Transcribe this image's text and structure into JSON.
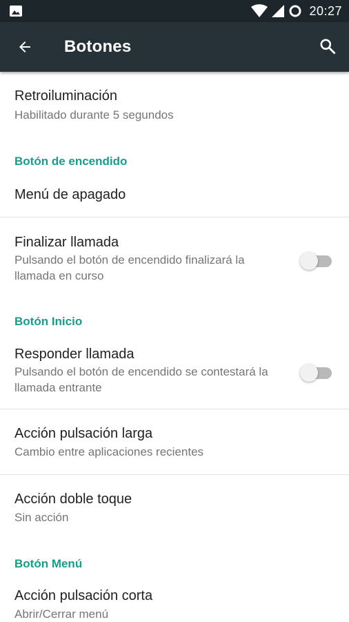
{
  "status_bar": {
    "time": "20:27",
    "icons": [
      "image-icon",
      "wifi-icon",
      "signal-icon",
      "battery-ring-icon"
    ]
  },
  "app_bar": {
    "title": "Botones",
    "back_icon": "arrow-left-icon",
    "search_icon": "search-icon"
  },
  "colors": {
    "status_bar_bg": "#1d262a",
    "app_bar_bg": "#263238",
    "accent": "#149e8c",
    "title_text": "#212121",
    "secondary_text": "#757575"
  },
  "settings": {
    "backlight": {
      "title": "Retroiluminación",
      "summary": "Habilitado durante 5 segundos"
    },
    "power_section": "Botón de encendido",
    "power_menu": {
      "title": "Menú de apagado"
    },
    "end_call": {
      "title": "Finalizar llamada",
      "summary": "Pulsando el botón de encendido finalizará la llamada en curso",
      "enabled": false
    },
    "home_section": "Botón Inicio",
    "answer_call": {
      "title": "Responder llamada",
      "summary": "Pulsando el botón de encendido se contestará la llamada entrante",
      "enabled": false
    },
    "long_press": {
      "title": "Acción pulsación larga",
      "summary": "Cambio entre aplicaciones recientes"
    },
    "double_tap": {
      "title": "Acción doble toque",
      "summary": "Sin acción"
    },
    "menu_section": "Botón Menú",
    "short_press": {
      "title": "Acción pulsación corta",
      "summary": "Abrir/Cerrar menú"
    }
  }
}
